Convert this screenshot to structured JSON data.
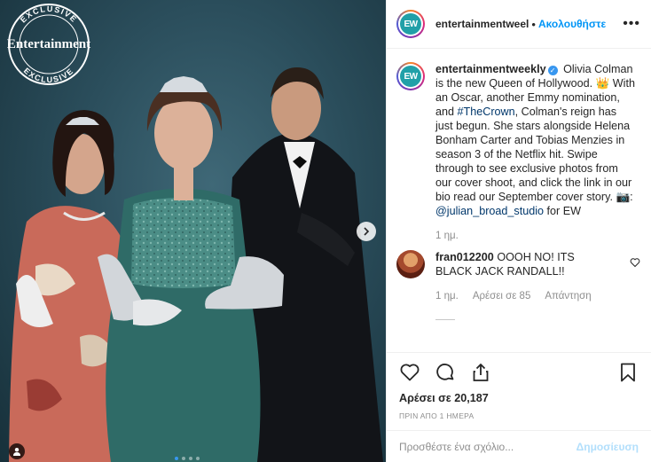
{
  "photo": {
    "seal_text": "EXCLUSIVE",
    "seal_brand": "Entertainment",
    "icons": {
      "next": "chevron-right-icon",
      "tag": "user-tag-icon"
    },
    "carousel": {
      "count": 4,
      "active": 0
    }
  },
  "header": {
    "avatar_label": "EW",
    "username": "entertainmentweel",
    "separator": "•",
    "follow_label": "Ακολουθήστε",
    "more_label": "•••"
  },
  "caption": {
    "username": "entertainmentweekly",
    "verified_glyph": "✓",
    "text_1": " Olivia Colman is the new Queen of Hollywood. 👑 With an Oscar, another Emmy nomination, and ",
    "hashtag": "#TheCrown",
    "text_2": ", Colman's reign has just begun. She stars alongside Helena Bonham Carter and Tobias Menzies in season 3 of the Netflix hit. Swipe through to see exclusive photos from our cover shoot, and click the link in our bio read our September cover story. 📷: ",
    "mention": "@julian_broad_studio",
    "text_3": " for EW",
    "time": "1 ημ."
  },
  "comment": {
    "username": "fran012200",
    "text": " OOOH NO! ITS BLACK JACK RANDALL!!",
    "time": "1 ημ.",
    "likes": "Αρέσει σε 85",
    "reply_label": "Απάντηση"
  },
  "actions": {
    "icons": [
      "heart-icon",
      "comment-icon",
      "share-icon",
      "bookmark-icon"
    ],
    "likes": "Αρέσει σε 20,187",
    "timestamp": "ΠΡΙΝ ΑΠΟ 1 ΗΜΕΡΑ"
  },
  "add_comment": {
    "placeholder": "Προσθέστε ένα σχόλιο...",
    "post_label": "Δημοσίευση"
  },
  "colors": {
    "link_blue": "#0095f6",
    "verified_blue": "#3897f0",
    "ew_teal": "#21a0a8",
    "muted_gray": "#8e8e8e"
  }
}
